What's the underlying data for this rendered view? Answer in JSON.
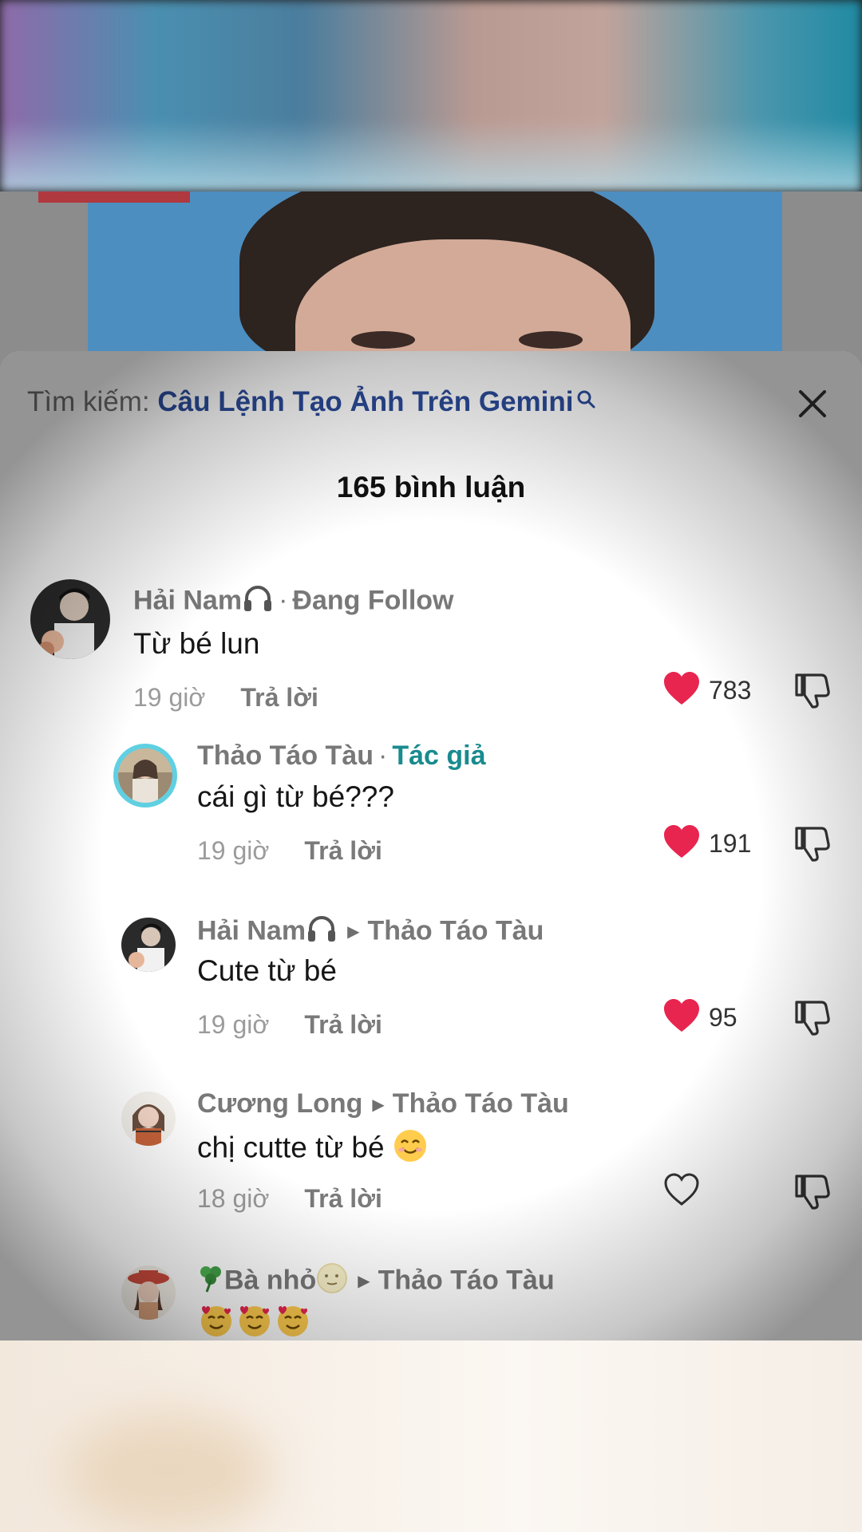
{
  "search": {
    "prefix": "Tìm kiếm:",
    "query": "Câu Lệnh Tạo Ảnh Trên Gemini"
  },
  "sheet": {
    "title": "165 bình luận"
  },
  "colors": {
    "like_active": "#e8254f",
    "author_badge": "#198b8f",
    "search_link": "#2b4b9a"
  },
  "comments": [
    {
      "user": "Hải Nam",
      "user_icon": "headphones-icon",
      "suffix": "Đang Follow",
      "text": "Từ bé lun",
      "time": "19 giờ",
      "reply_label": "Trả lời",
      "likes": "783",
      "liked": true
    },
    {
      "user": "Thảo Táo Tàu",
      "suffix": "Tác giả",
      "text": "cái gì từ bé???",
      "time": "19 giờ",
      "reply_label": "Trả lời",
      "likes": "191",
      "liked": true
    },
    {
      "user": "Hải Nam",
      "user_icon": "headphones-icon",
      "reply_to": "Thảo Táo Tàu",
      "text": "Cute từ bé",
      "time": "19 giờ",
      "reply_label": "Trả lời",
      "likes": "95",
      "liked": true
    },
    {
      "user": "Cương Long",
      "reply_to": "Thảo Táo Tàu",
      "text": "chị cutte từ bé",
      "text_emoji": "smiling-face-icon",
      "time": "18 giờ",
      "reply_label": "Trả lời",
      "likes": "",
      "liked": false
    },
    {
      "user_prefix_icon": "clover-icon",
      "user": "Bà nhỏ",
      "user_icon": "moon-face-icon",
      "reply_to": "Thảo Táo Tàu",
      "text_emoji": "smiling-face-with-hearts-icon x3"
    }
  ]
}
